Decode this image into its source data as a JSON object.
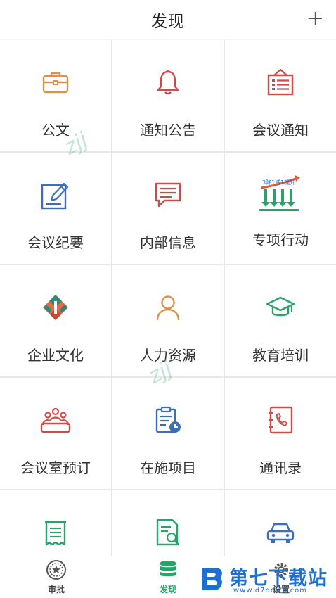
{
  "header": {
    "title": "发现",
    "add_label": "+"
  },
  "grid": {
    "items": [
      {
        "label": "公文",
        "icon": "briefcase-icon"
      },
      {
        "label": "通知公告",
        "icon": "bell-icon"
      },
      {
        "label": "会议通知",
        "icon": "meeting-notice-icon"
      },
      {
        "label": "会议纪要",
        "icon": "edit-note-icon"
      },
      {
        "label": "内部信息",
        "icon": "message-icon"
      },
      {
        "label": "专项行动",
        "icon": "special-action-icon"
      },
      {
        "label": "企业文化",
        "icon": "culture-logo-icon"
      },
      {
        "label": "人力资源",
        "icon": "person-icon"
      },
      {
        "label": "教育培训",
        "icon": "graduation-cap-icon"
      },
      {
        "label": "会议室预订",
        "icon": "meeting-room-icon"
      },
      {
        "label": "在施项目",
        "icon": "project-clipboard-icon"
      },
      {
        "label": "通讯录",
        "icon": "contacts-phone-icon"
      },
      {
        "label": "",
        "icon": "receipt-icon"
      },
      {
        "label": "",
        "icon": "document-search-icon"
      },
      {
        "label": "",
        "icon": "car-icon"
      }
    ]
  },
  "special_action_banner": "3降1减1提升",
  "watermarks": [
    "zjj",
    "zjj"
  ],
  "tabbar": {
    "tabs": [
      {
        "label": "审批",
        "icon": "approval-badge-icon",
        "active": false
      },
      {
        "label": "发现",
        "icon": "database-stack-icon",
        "active": true
      },
      {
        "label": "设置",
        "icon": "gear-icon",
        "active": false
      }
    ]
  },
  "site_logo": {
    "brand": "第七下载站",
    "url": "www.d7down.com"
  },
  "colors": {
    "accent_green": "#2aa36b",
    "icon_orange": "#d9944a",
    "icon_red": "#cf4b47",
    "icon_blue": "#3d6fb8",
    "logo_blue": "#1f6fd1"
  }
}
